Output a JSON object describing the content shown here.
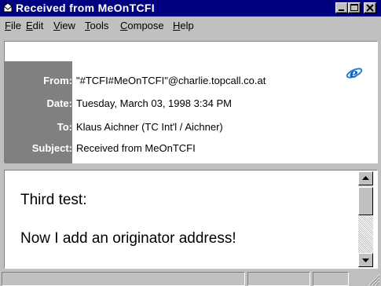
{
  "window": {
    "title": "Received from MeOnTCFI",
    "icon": "envelope-icon"
  },
  "menu": [
    {
      "label_ul": "F",
      "label_rest": "ile"
    },
    {
      "label_ul": "E",
      "label_rest": "dit"
    },
    {
      "label_ul": "V",
      "label_rest": "iew"
    },
    {
      "label_ul": "T",
      "label_rest": "ools"
    },
    {
      "label_ul": "C",
      "label_rest": "ompose"
    },
    {
      "label_ul": "H",
      "label_rest": "elp"
    }
  ],
  "header": {
    "from_label": "From:",
    "from_value": "\"#TCFI#MeOnTCFI\"@charlie.topcall.co.at",
    "date_label": "Date:",
    "date_value": "Tuesday, March 03, 1998 3:34 PM",
    "to_label": "To:",
    "to_value": "Klaus Aichner (TC Int'l / Aichner)",
    "subject_label": "Subject:",
    "subject_value": "Received from MeOnTCFI",
    "logo_icon": "internet-explorer-icon"
  },
  "body": {
    "line1": "Third test:",
    "line2": "Now I add an originator address!"
  },
  "colors": {
    "titlebar": "#000080",
    "face": "#c0c0c0",
    "label_bg": "#808080"
  }
}
